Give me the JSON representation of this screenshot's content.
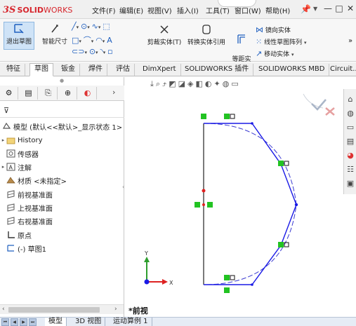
{
  "app": {
    "logo_ds": "3S",
    "logo_solid": "SOLID",
    "logo_works": "WORKS"
  },
  "menu": [
    {
      "label": "文件(F)"
    },
    {
      "label": "编辑(E)"
    },
    {
      "label": "视图(V)"
    },
    {
      "label": "插入(I)"
    },
    {
      "label": "工具(T)"
    },
    {
      "label": "窗口(W)"
    },
    {
      "label": "帮助(H)"
    }
  ],
  "window_controls": {
    "minimize": "—",
    "restore": "□",
    "close": "✕"
  },
  "ribbon": {
    "exit_sketch": "退出草图",
    "smart_dimension": "智能尺寸",
    "trim": "剪裁实体(T)",
    "convert": "转换实体引用",
    "offset": "等距实\n体",
    "mirror": "镜向实体",
    "linear_pattern": "线性草图阵列",
    "move": "移动实体",
    "more": "»"
  },
  "tabs": [
    {
      "label": "特征"
    },
    {
      "label": "草图"
    },
    {
      "label": "钣金"
    },
    {
      "label": "焊件"
    },
    {
      "label": "评估"
    },
    {
      "label": "DimXpert"
    },
    {
      "label": "SOLIDWORKS 插件"
    },
    {
      "label": "SOLIDWORKS MBD"
    },
    {
      "label": "Circuit..."
    }
  ],
  "active_tab": "草图",
  "tree": {
    "root": "模型 (默认<<默认>_显示状态 1>",
    "items": [
      {
        "label": "History",
        "expandable": true
      },
      {
        "label": "传感器",
        "expandable": false
      },
      {
        "label": "注解",
        "expandable": true
      },
      {
        "label": "材质 <未指定>",
        "expandable": false
      },
      {
        "label": "前视基准面",
        "expandable": false
      },
      {
        "label": "上视基准面",
        "expandable": false
      },
      {
        "label": "右视基准面",
        "expandable": false
      },
      {
        "label": "原点",
        "expandable": false
      },
      {
        "label": "(-) 草图1",
        "expandable": false
      }
    ]
  },
  "graphics": {
    "view_name": "*前视",
    "triad_x": "X",
    "triad_y": "Y"
  },
  "bottom_tabs": [
    {
      "label": "模型"
    },
    {
      "label": "3D 视图"
    },
    {
      "label": "运动算例 1"
    }
  ],
  "colors": {
    "sketch_line": "#1a1ae6",
    "construction_arc": "#3a3ad0",
    "centerline": "#111111",
    "relation_badge": "#22c322",
    "accent_red": "#d7262d"
  }
}
